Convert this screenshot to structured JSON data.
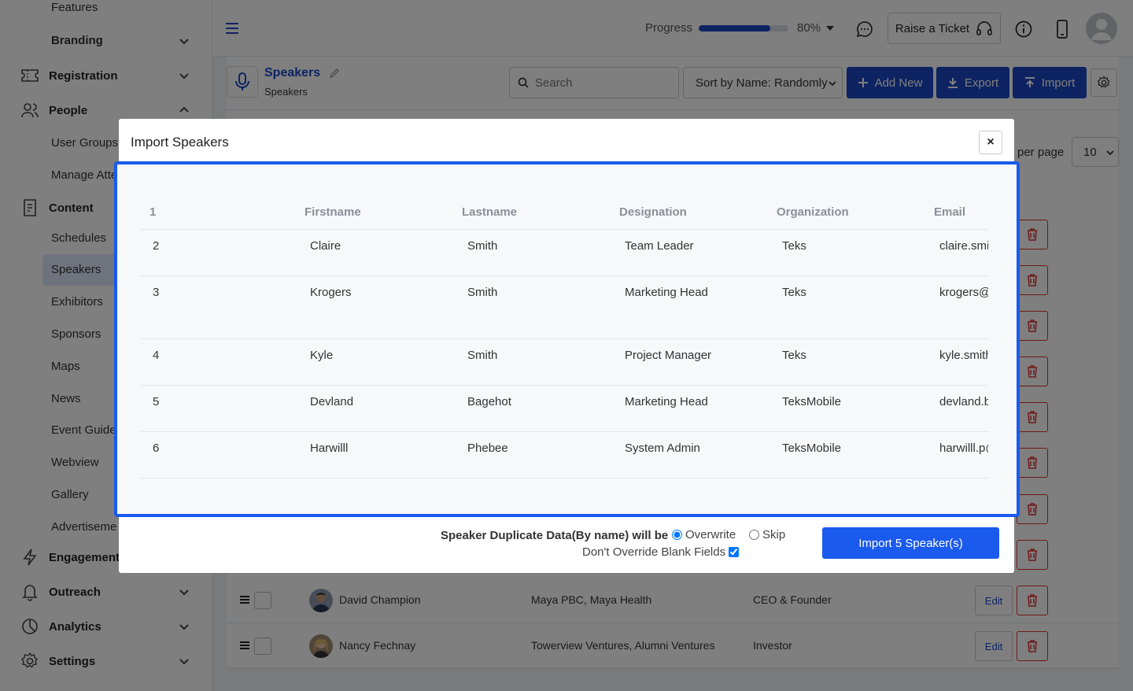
{
  "sidebar": {
    "features": "Features",
    "branding": "Branding",
    "registration": "Registration",
    "people": "People",
    "user_groups": "User Groups",
    "manage_attendees": "Manage Atte",
    "content": "Content",
    "schedules": "Schedules",
    "speakers": "Speakers",
    "exhibitors": "Exhibitors",
    "sponsors": "Sponsors",
    "maps": "Maps",
    "news": "News",
    "event_guide": "Event Guide",
    "webview": "Webview",
    "gallery": "Gallery",
    "advertisements": "Advertiseme",
    "engagement": "Engagement",
    "outreach": "Outreach",
    "analytics": "Analytics",
    "settings": "Settings"
  },
  "header": {
    "progress_label": "Progress",
    "progress_value": "80%",
    "progress_fraction": 0.8,
    "raise_ticket": "Raise a Ticket"
  },
  "page": {
    "title": "Speakers",
    "subtitle": "Speakers",
    "search_placeholder": "Search",
    "sort_value": "Sort by Name: Randomly",
    "add_new": "Add New",
    "export": "Export",
    "import": "Import",
    "per_page_label": "per page",
    "per_page_value": "10",
    "edit_label": "Edit",
    "rows": [
      {
        "name": "David Champion",
        "org": "Maya PBC, Maya Health",
        "title": "CEO & Founder"
      },
      {
        "name": "Nancy Fechnay",
        "org": "Towerview Ventures, Alumni Ventures",
        "title": "Investor"
      }
    ]
  },
  "modal": {
    "title": "Import Speakers",
    "close": "×",
    "columns": [
      "1",
      "Firstname",
      "Lastname",
      "Designation",
      "Organization",
      "Email"
    ],
    "rows": [
      [
        "2",
        "Claire",
        "Smith",
        "Team Leader",
        "Teks",
        "claire.smith@teks.com"
      ],
      [
        "3",
        "Krogers",
        "Smith",
        "Marketing Head",
        "Teks",
        "krogers@teks.com"
      ],
      [
        "4",
        "Kyle",
        "Smith",
        "Project Manager",
        "Teks",
        "kyle.smith@teks.com"
      ],
      [
        "5",
        "Devland",
        "Bagehot",
        "Marketing Head",
        "TeksMobile",
        "devland.b@teksmobile.com"
      ],
      [
        "6",
        "Harwilll",
        "Phebee",
        "System Admin",
        "TeksMobile",
        "harwilll.p@teksmobile.com"
      ]
    ],
    "duplicate_label": "Speaker Duplicate Data(By name) will be",
    "overwrite": "Overwrite",
    "skip": "Skip",
    "dont_override": "Don't Override Blank Fields",
    "import_button": "Import 5 Speaker(s)"
  },
  "colors": {
    "accent": "#1a47c4",
    "modal_highlight": "#1a5aec",
    "danger": "#dd3333"
  }
}
